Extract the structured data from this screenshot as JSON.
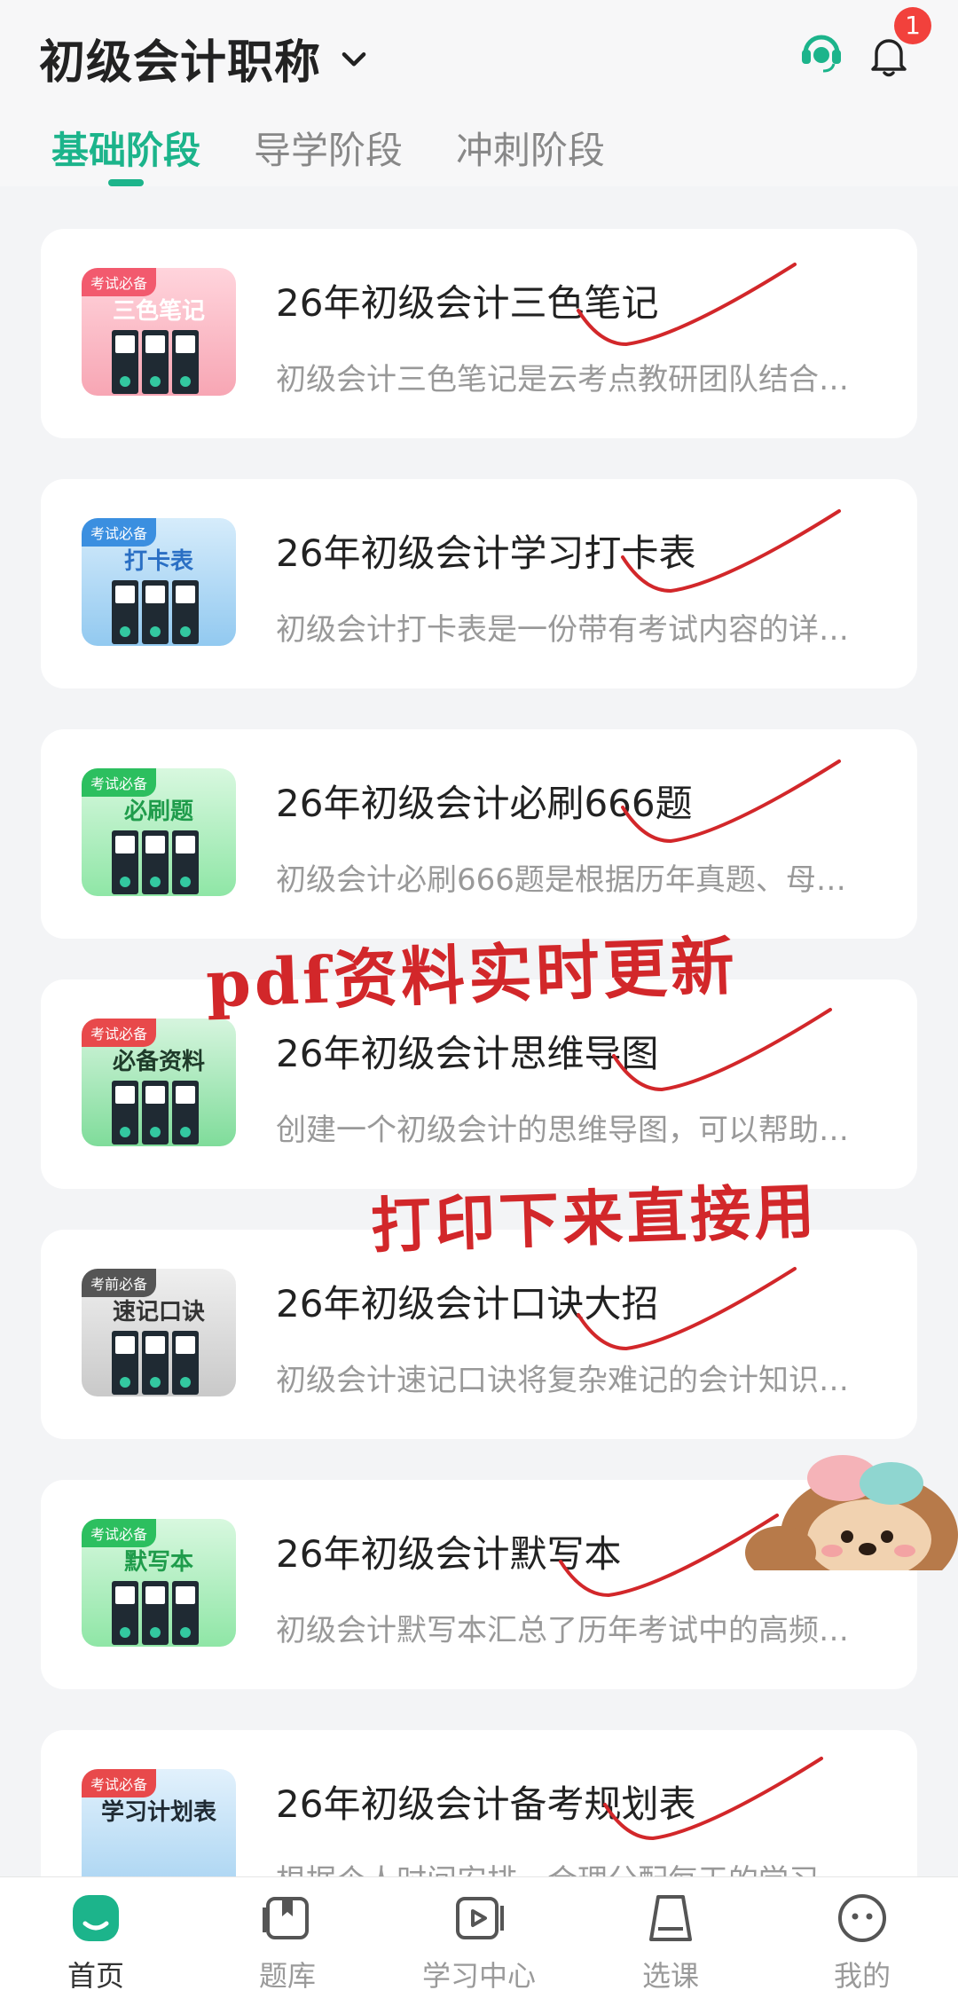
{
  "header": {
    "title": "初级会计职称",
    "notification_count": "1"
  },
  "tabs": [
    {
      "label": "基础阶段",
      "active": true
    },
    {
      "label": "导学阶段",
      "active": false
    },
    {
      "label": "冲刺阶段",
      "active": false
    }
  ],
  "cards": [
    {
      "title": "26年初级会计三色笔记",
      "desc": "初级会计三色笔记是云考点教研团队结合…",
      "thumb_tag": "考试必备",
      "thumb_title": "三色笔记",
      "color": "#f7a6b4"
    },
    {
      "title": "26年初级会计学习打卡表",
      "desc": "初级会计打卡表是一份带有考试内容的详…",
      "thumb_tag": "考试必备",
      "thumb_title": "打卡表",
      "color": "#92c9f0"
    },
    {
      "title": "26年初级会计必刷666题",
      "desc": "初级会计必刷666题是根据历年真题、母…",
      "thumb_tag": "考试必备",
      "thumb_title": "必刷题",
      "color": "#8fe6a6"
    },
    {
      "title": "26年初级会计思维导图",
      "desc": "创建一个初级会计的思维导图，可以帮助…",
      "thumb_tag": "考试必备",
      "thumb_title": "必备资料",
      "color": "#7fdc9a"
    },
    {
      "title": "26年初级会计口诀大招",
      "desc": "初级会计速记口诀将复杂难记的会计知识…",
      "thumb_tag": "考前必备",
      "thumb_title": "速记口诀",
      "color": "#c9c9c9"
    },
    {
      "title": "26年初级会计默写本",
      "desc": "初级会计默写本汇总了历年考试中的高频…",
      "thumb_tag": "考试必备",
      "thumb_title": "默写本",
      "color": "#8fe6a6"
    },
    {
      "title": "26年初级会计备考规划表",
      "desc": "根据个人时间安排，合理分配每天的学习…",
      "thumb_tag": "考试必备",
      "thumb_title": "学习计划表",
      "color": "#a7d3f2"
    }
  ],
  "overlays": {
    "line1": "pdf资料实时更新",
    "line2": "打印下来直接用"
  },
  "nav": [
    {
      "label": "首页",
      "icon": "home-icon"
    },
    {
      "label": "题库",
      "icon": "question-bank-icon"
    },
    {
      "label": "学习中心",
      "icon": "study-center-icon"
    },
    {
      "label": "选课",
      "icon": "course-icon"
    },
    {
      "label": "我的",
      "icon": "profile-icon"
    }
  ],
  "colors": {
    "accent": "#1cb48b",
    "badge": "#f2413c",
    "annotation_red": "#d2272a"
  }
}
